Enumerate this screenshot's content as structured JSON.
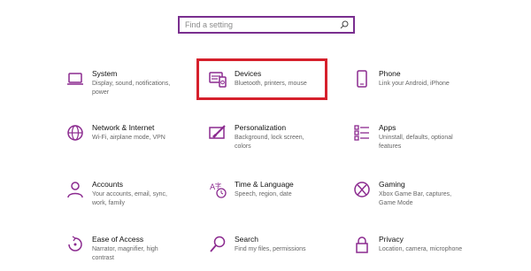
{
  "search": {
    "placeholder": "Find a setting",
    "icon": "search-icon"
  },
  "accent_color": "#8b2a8f",
  "highlight_color": "#d6202c",
  "tiles": [
    {
      "title": "System",
      "desc": "Display, sound, notifications, power",
      "icon": "laptop-icon"
    },
    {
      "title": "Devices",
      "desc": "Bluetooth, printers, mouse",
      "icon": "devices-icon",
      "highlighted": true
    },
    {
      "title": "Phone",
      "desc": "Link your Android, iPhone",
      "icon": "phone-icon"
    },
    {
      "title": "Network & Internet",
      "desc": "Wi-Fi, airplane mode, VPN",
      "icon": "globe-icon"
    },
    {
      "title": "Personalization",
      "desc": "Background, lock screen, colors",
      "icon": "paintbrush-icon"
    },
    {
      "title": "Apps",
      "desc": "Uninstall, defaults, optional features",
      "icon": "apps-list-icon"
    },
    {
      "title": "Accounts",
      "desc": "Your accounts, email, sync, work, family",
      "icon": "person-icon"
    },
    {
      "title": "Time & Language",
      "desc": "Speech, region, date",
      "icon": "time-language-icon"
    },
    {
      "title": "Gaming",
      "desc": "Xbox Game Bar, captures, Game Mode",
      "icon": "xbox-icon"
    },
    {
      "title": "Ease of Access",
      "desc": "Narrator, magnifier, high contrast",
      "icon": "ease-of-access-icon"
    },
    {
      "title": "Search",
      "desc": "Find my files, permissions",
      "icon": "magnifier-icon"
    },
    {
      "title": "Privacy",
      "desc": "Location, camera, microphone",
      "icon": "lock-icon"
    }
  ]
}
